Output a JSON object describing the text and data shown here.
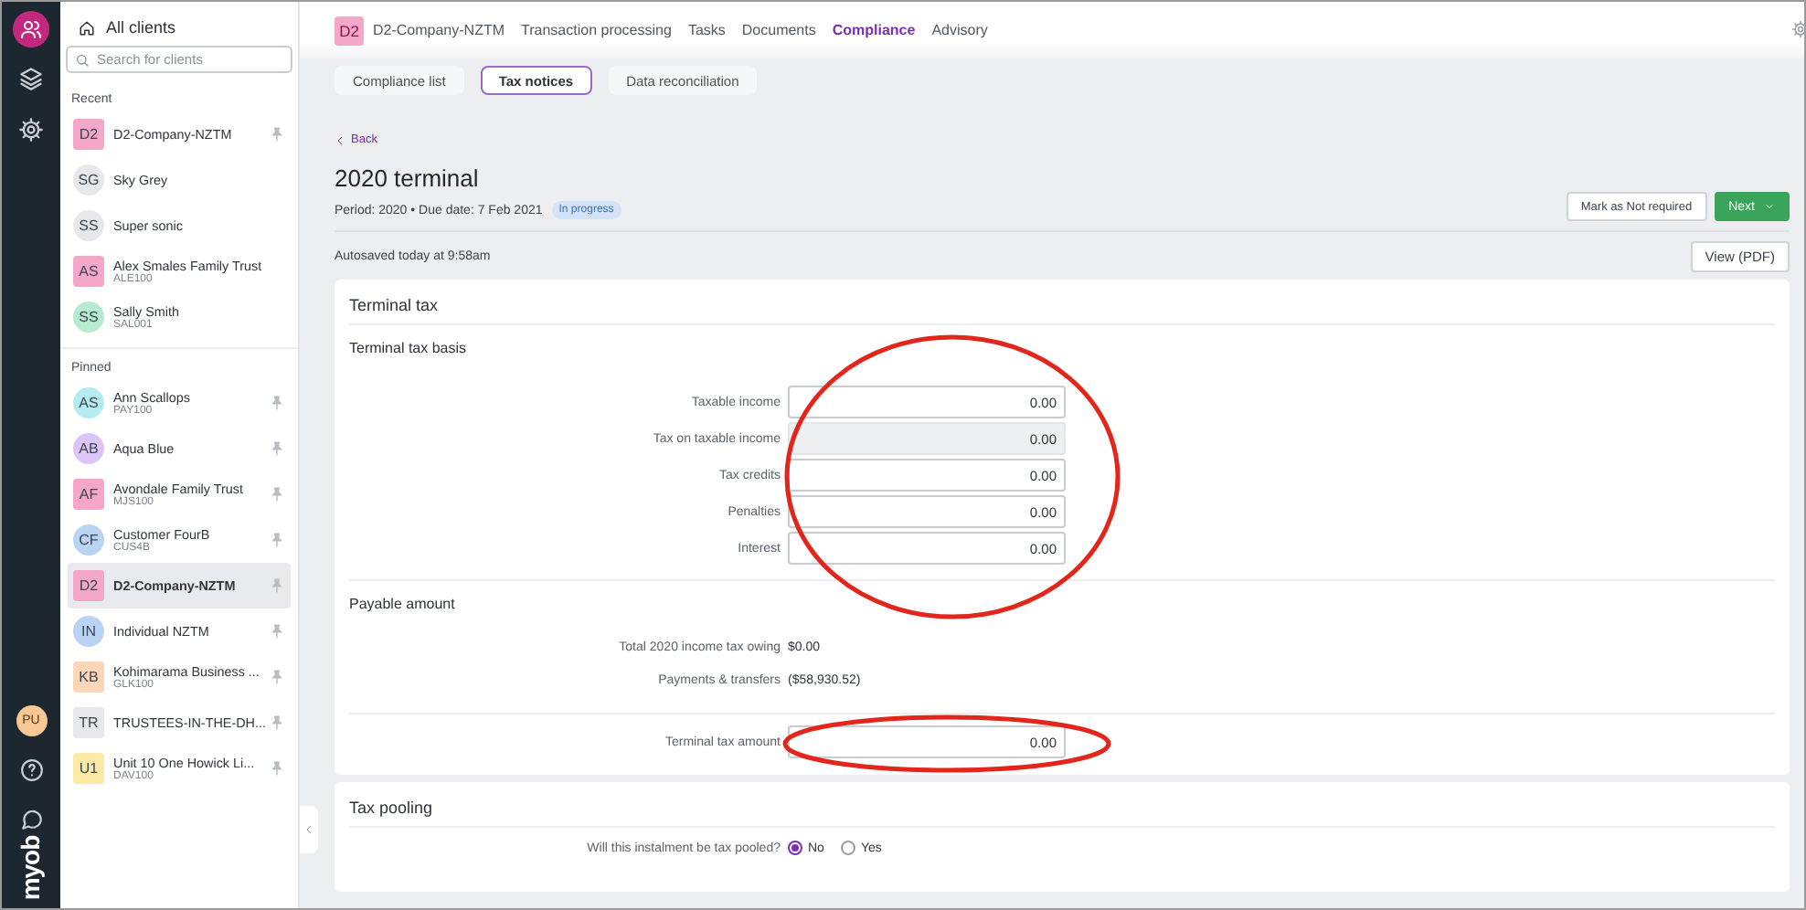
{
  "rail": {
    "user_initials": "PU",
    "logo": "myob"
  },
  "sidebar": {
    "title": "All clients",
    "search": {
      "placeholder": "Search for clients"
    },
    "sections": [
      {
        "heading": "Recent",
        "clients": [
          {
            "initials": "D2",
            "name": "D2-Company-NZTM",
            "kind": "organisation",
            "color": "#f4a7c9",
            "pinned": true,
            "selected": false
          },
          {
            "initials": "SG",
            "name": "Sky Grey",
            "kind": "person",
            "color": "#e6e8eb",
            "pinned": false,
            "selected": false
          },
          {
            "initials": "SS",
            "name": "Super sonic",
            "kind": "person",
            "color": "#e6e8eb",
            "pinned": false,
            "selected": false
          },
          {
            "initials": "AS",
            "name": "Alex Smales Family Trust",
            "code": "ALE100",
            "kind": "organisation",
            "color": "#f4a7c9",
            "pinned": false,
            "selected": false
          },
          {
            "initials": "SS",
            "name": "Sally Smith",
            "code": "SAL001",
            "kind": "person",
            "color": "#b7ebcf",
            "pinned": false,
            "selected": false
          }
        ]
      },
      {
        "heading": "Pinned",
        "clients": [
          {
            "initials": "AS",
            "name": "Ann Scallops",
            "code": "PAY100",
            "kind": "person",
            "color": "#b5ecf2",
            "pinned": true,
            "selected": false
          },
          {
            "initials": "AB",
            "name": "Aqua Blue",
            "kind": "person",
            "color": "#dcc6f7",
            "pinned": true,
            "selected": false
          },
          {
            "initials": "AF",
            "name": "Avondale Family Trust",
            "code": "MJS100",
            "kind": "organisation",
            "color": "#f4a7c9",
            "pinned": true,
            "selected": false
          },
          {
            "initials": "CF",
            "name": "Customer FourB",
            "code": "CUS4B",
            "kind": "person",
            "color": "#b9d3f5",
            "pinned": true,
            "selected": false
          },
          {
            "initials": "D2",
            "name": "D2-Company-NZTM",
            "kind": "organisation",
            "color": "#f4a7c9",
            "pinned": true,
            "selected": true
          },
          {
            "initials": "IN",
            "name": "Individual NZTM",
            "kind": "person",
            "color": "#b9d3f5",
            "pinned": true,
            "selected": false
          },
          {
            "initials": "KB",
            "name": "Kohimarama Business ...",
            "code": "GLK100",
            "kind": "organisation",
            "color": "#fbd6b8",
            "pinned": true,
            "selected": false
          },
          {
            "initials": "TR",
            "name": "TRUSTEES-IN-THE-DH...",
            "kind": "organisation",
            "color": "#e6e8eb",
            "pinned": true,
            "selected": false
          },
          {
            "initials": "U1",
            "name": "Unit 10 One Howick Li...",
            "code": "DAV100",
            "kind": "organisation",
            "color": "#fbeaa6",
            "pinned": true,
            "selected": false
          }
        ]
      }
    ]
  },
  "header": {
    "client_badge": "D2",
    "client_name": "D2-Company-NZTM",
    "nav": [
      {
        "label": "Transaction processing",
        "selected": false
      },
      {
        "label": "Tasks",
        "selected": false
      },
      {
        "label": "Documents",
        "selected": false
      },
      {
        "label": "Compliance",
        "selected": true
      },
      {
        "label": "Advisory",
        "selected": false
      }
    ]
  },
  "subtabs": [
    {
      "label": "Compliance list",
      "selected": false
    },
    {
      "label": "Tax notices",
      "selected": true
    },
    {
      "label": "Data reconciliation",
      "selected": false
    }
  ],
  "back": "Back",
  "title": "2020 terminal",
  "meta": "Period: 2020 • Due date: 7 Feb 2021",
  "status": "In progress",
  "actions": [
    {
      "label": "Mark as Not required",
      "kind": "secondary"
    },
    {
      "label": "Next",
      "kind": "primary"
    }
  ],
  "autosaved": "Autosaved today at 9:58am",
  "view_button": "View (PDF)",
  "terminal_tax": {
    "title": "Terminal tax",
    "basis": {
      "heading": "Terminal tax basis",
      "circled": true,
      "fields": [
        {
          "label": "Taxable income",
          "value": "0.00",
          "disabled": false
        },
        {
          "label": "Tax on taxable income",
          "value": "0.00",
          "disabled": true
        },
        {
          "label": "Tax credits",
          "value": "0.00",
          "disabled": false
        },
        {
          "label": "Penalties",
          "value": "0.00",
          "disabled": false
        },
        {
          "label": "Interest",
          "value": "0.00",
          "disabled": false
        }
      ]
    },
    "payable": {
      "heading": "Payable amount",
      "rows": [
        {
          "label": "Total 2020 income tax owing",
          "value": "$0.00"
        },
        {
          "label": "Payments & transfers",
          "value": "($58,930.52)"
        }
      ],
      "amount": {
        "label": "Terminal tax amount",
        "value": "0.00",
        "circled": true
      }
    }
  },
  "tax_pooling": {
    "title": "Tax pooling",
    "question": "Will this instalment be tax pooled?",
    "options": [
      {
        "label": "No",
        "selected": true
      },
      {
        "label": "Yes",
        "selected": false
      }
    ]
  }
}
